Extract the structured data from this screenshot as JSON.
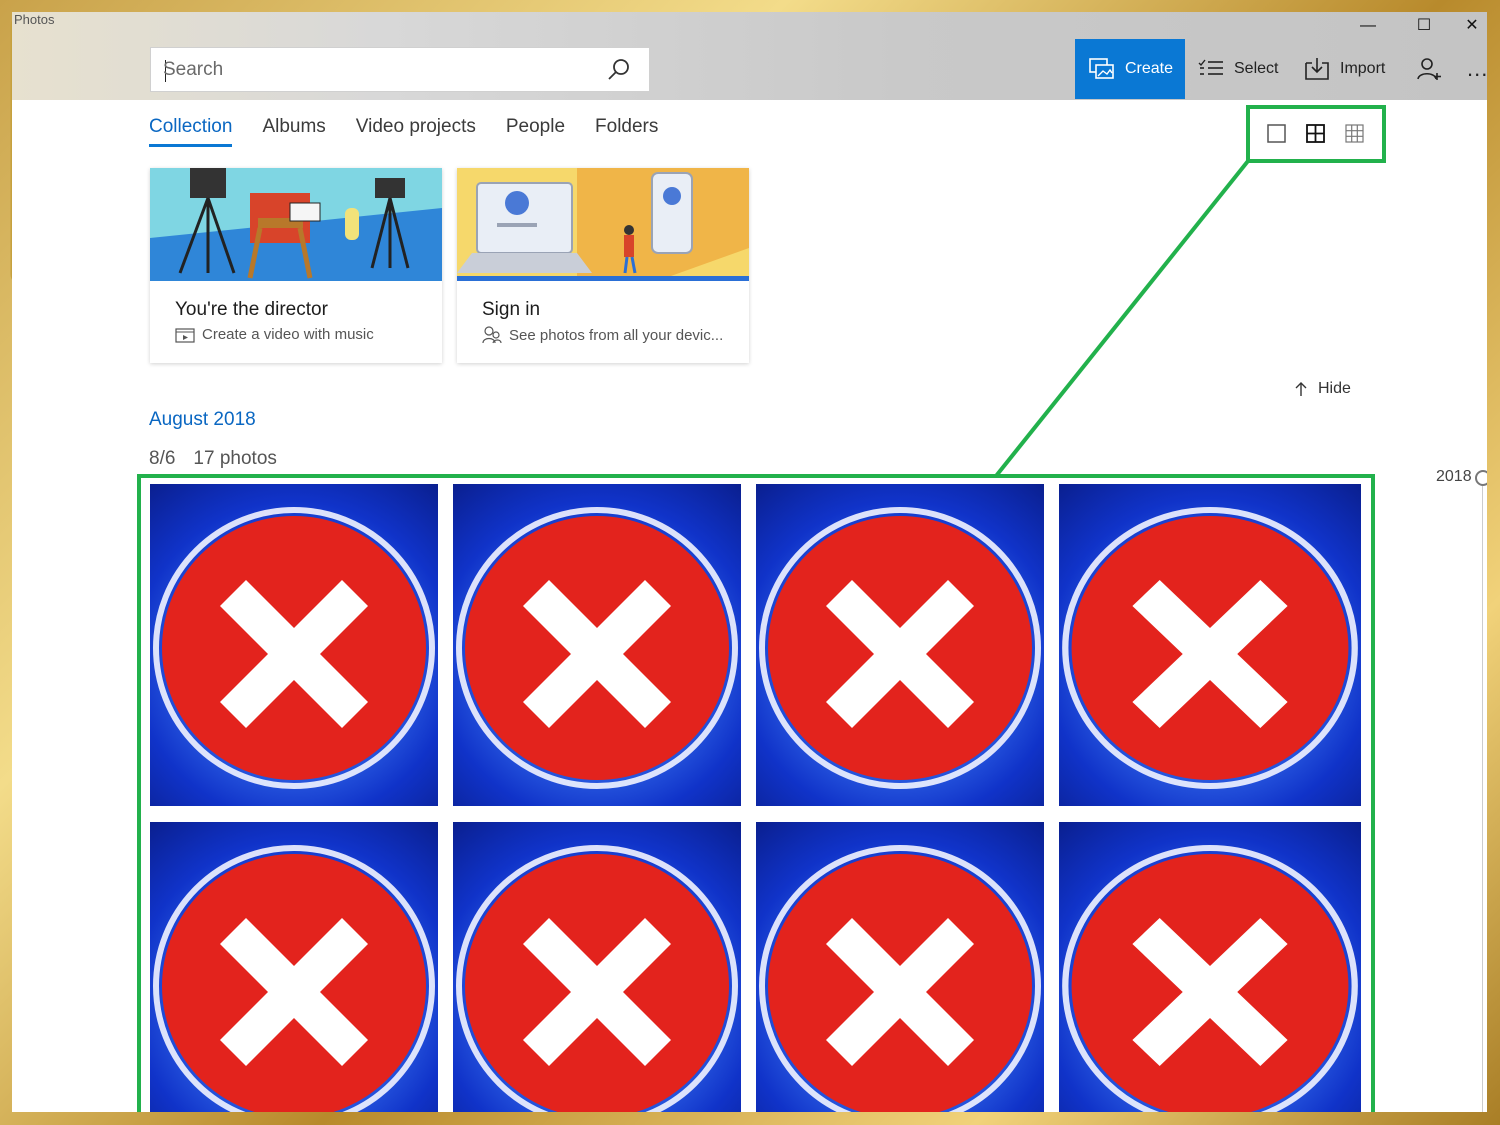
{
  "app": {
    "title": "Photos"
  },
  "window_controls": {
    "minimize": "—",
    "maximize": "☐",
    "close": "✕"
  },
  "search": {
    "placeholder": "Search",
    "icon": "search-icon"
  },
  "toolbar": {
    "create_label": "Create",
    "select_label": "Select",
    "import_label": "Import",
    "account_icon": "person-add-icon",
    "more_label": "..."
  },
  "nav": {
    "tabs": [
      {
        "label": "Collection",
        "active": true
      },
      {
        "label": "Albums",
        "active": false
      },
      {
        "label": "Video projects",
        "active": false
      },
      {
        "label": "People",
        "active": false
      },
      {
        "label": "Folders",
        "active": false
      }
    ]
  },
  "view_modes": {
    "selected": "medium-grid",
    "options": [
      "large-tile",
      "medium-grid",
      "small-grid"
    ]
  },
  "cards": [
    {
      "title": "You're the director",
      "subtitle": "Create a video with music",
      "icon": "video-project-icon"
    },
    {
      "title": "Sign in",
      "subtitle": "See photos from all your devic...",
      "icon": "people-icon"
    }
  ],
  "hide_label": "Hide",
  "collection": {
    "month": "August 2018",
    "date": "8/6",
    "count": "17 photos",
    "year_marker": "2018",
    "thumbnail_count_visible": 8
  },
  "colors": {
    "accent": "#0a78d4",
    "highlight": "#22b14c",
    "frame_gold": "#c9a24a"
  }
}
